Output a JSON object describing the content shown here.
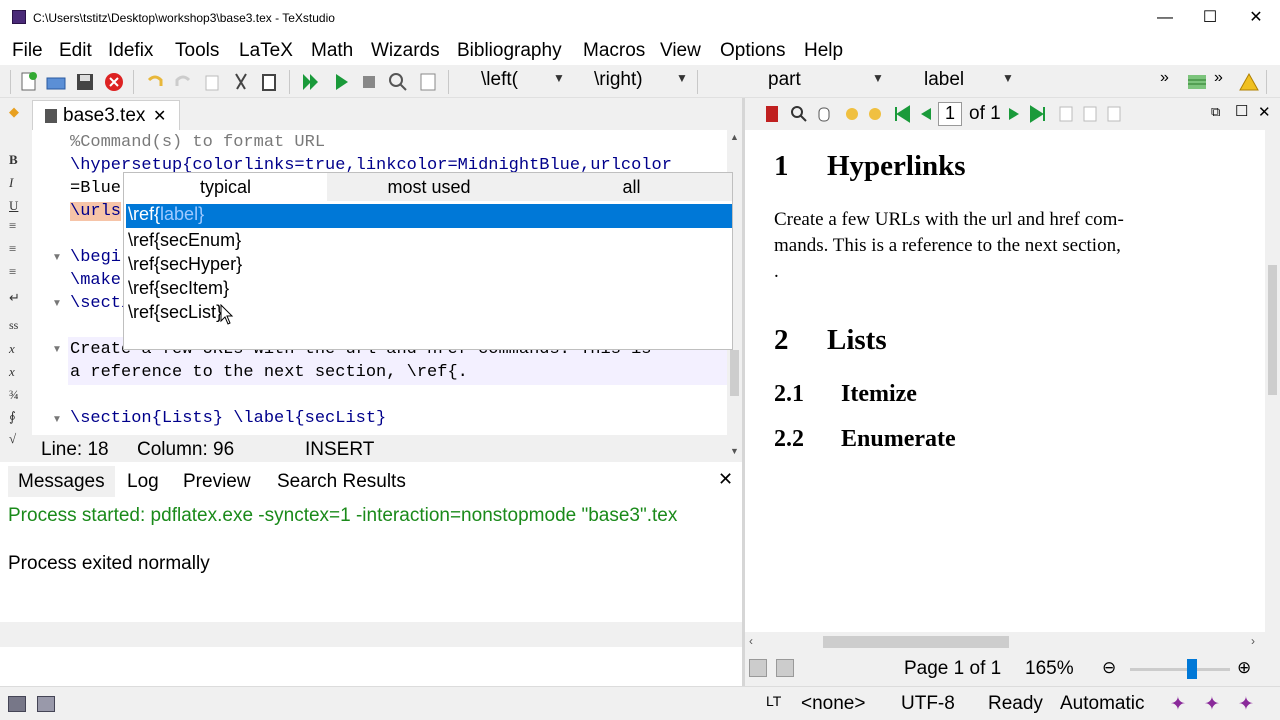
{
  "window": {
    "title": "C:\\Users\\tstitz\\Desktop\\workshop3\\base3.tex - TeXstudio",
    "minimize": "—",
    "maximize": "☐",
    "close": "✕"
  },
  "menu": [
    "File",
    "Edit",
    "Idefix",
    "Tools",
    "LaTeX",
    "Math",
    "Wizards",
    "Bibliography",
    "Macros",
    "View",
    "Options",
    "Help"
  ],
  "toolbar": {
    "left_combo": "\\left(",
    "right_combo": "\\right)",
    "part_combo": "part",
    "label_combo": "label",
    "overflow": "»"
  },
  "tab": {
    "filename": "base3.tex",
    "close": "✕"
  },
  "editor": {
    "lines": [
      "%Command(s) to format URL",
      "\\hypersetup{colorlinks=true,linkcolor=MidnightBlue,urlcolor",
      "=Blue",
      "\\urls",
      "",
      "\\begi",
      "\\make",
      "\\secti",
      "",
      "Create a few URLs with the url and href commands. This is",
      "a reference to the next section, \\ref{.",
      "",
      "\\section{Lists} \\label{secList}"
    ],
    "status": {
      "line": "Line: 18",
      "column": "Column: 96",
      "mode": "INSERT"
    }
  },
  "completer": {
    "tabs": [
      "typical",
      "most used",
      "all"
    ],
    "items": [
      {
        "prefix": "\\ref{",
        "arg": "label",
        "suffix": "}"
      },
      {
        "prefix": "\\ref{",
        "arg": "secEnum",
        "suffix": "}"
      },
      {
        "prefix": "\\ref{",
        "arg": "secHyper",
        "suffix": "}"
      },
      {
        "prefix": "\\ref{",
        "arg": "secItem",
        "suffix": "}"
      },
      {
        "prefix": "\\ref{",
        "arg": "secList",
        "suffix": "}"
      }
    ]
  },
  "messages": {
    "tabs": [
      "Messages",
      "Log",
      "Preview",
      "Search Results"
    ],
    "close": "✕",
    "process_started": "Process started: pdflatex.exe -synctex=1 -interaction=nonstopmode \"base3\".tex",
    "process_exited": "Process exited normally"
  },
  "pdf": {
    "page_input": "1",
    "page_of": "of 1",
    "section1_num": "1",
    "section1_title": "Hyperlinks",
    "body1": "Create a few URLs with the url and href com-",
    "body2": "mands.  This is a reference to the next section,",
    "body3": ".",
    "section2_num": "2",
    "section2_title": "Lists",
    "sub1_num": "2.1",
    "sub1_title": "Itemize",
    "sub2_num": "2.2",
    "sub2_title": "Enumerate",
    "status_page": "Page 1 of 1",
    "zoom": "165%"
  },
  "statusbar": {
    "language": "<none>",
    "encoding": "UTF-8",
    "ready": "Ready",
    "mode": "Automatic"
  },
  "colors": {
    "selection": "#0078d7",
    "process_green": "#1a8a1a",
    "keyword": "#00008b",
    "comment": "#7a7a7a",
    "argument": "#006400"
  }
}
